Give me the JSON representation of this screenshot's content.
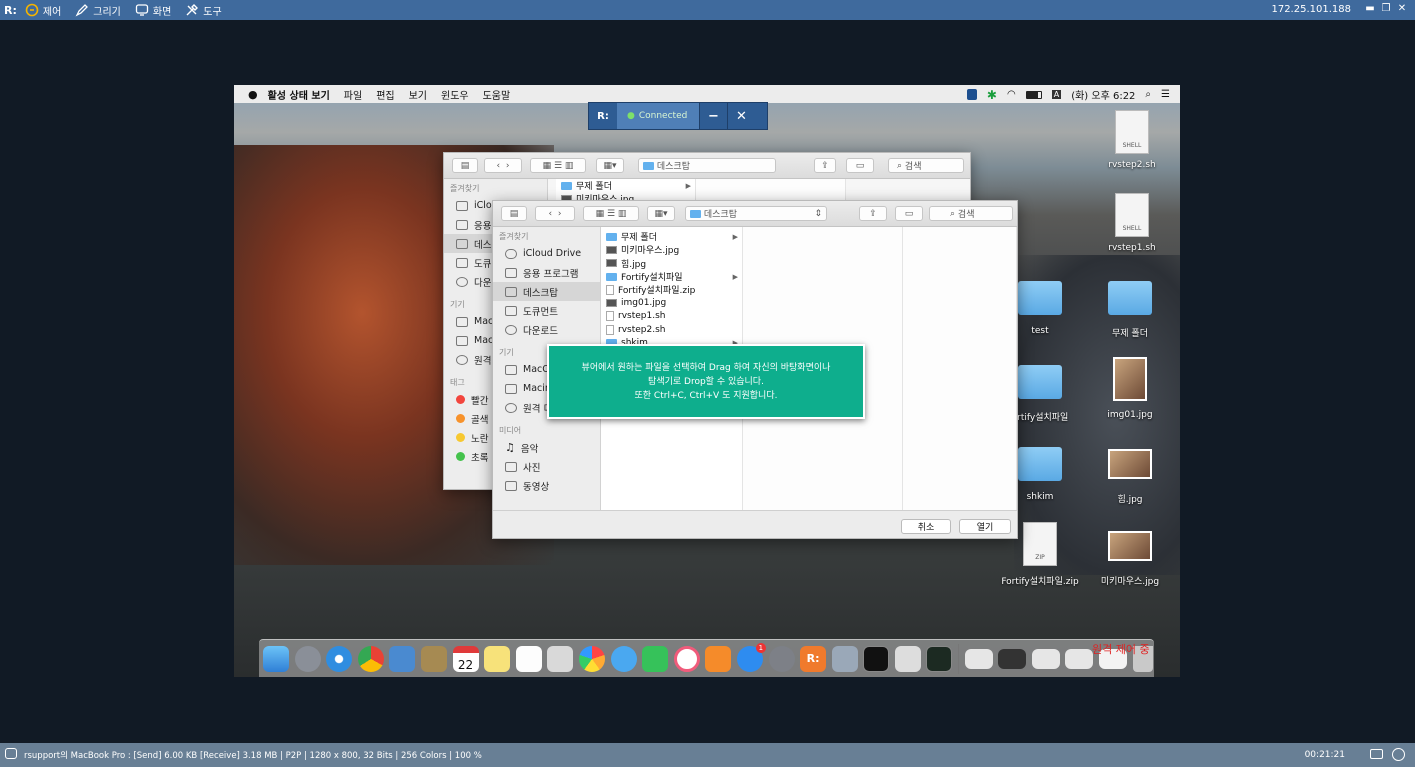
{
  "viewer": {
    "logo": "R:",
    "menu": [
      {
        "label": "제어",
        "icon": "control-icon"
      },
      {
        "label": "그리기",
        "icon": "pen-icon"
      },
      {
        "label": "화면",
        "icon": "screen-icon"
      },
      {
        "label": "도구",
        "icon": "tools-icon"
      }
    ],
    "ip": "172.25.101.188"
  },
  "connection": {
    "logo": "R:",
    "status": "Connected",
    "minimize": "−",
    "close": "✕"
  },
  "mac_menubar": {
    "items": [
      "활성 상태 보기",
      "파일",
      "편집",
      "보기",
      "윈도우",
      "도움말"
    ],
    "clock": "(화) 오후 6:22",
    "input_source": "A"
  },
  "back_finder": {
    "location": "데스크탑",
    "search": "검색",
    "favorites_header": "즐겨찾기",
    "favorites": [
      "iClo",
      "응용",
      "데스",
      "도큐",
      "다운"
    ],
    "devices_header": "기기",
    "devices": [
      "Mac",
      "Mac",
      "원격"
    ],
    "tags_header": "태그",
    "tags": [
      "빨간",
      "골색",
      "노란",
      "초록"
    ],
    "files": [
      "무제 폴더",
      "미키마우스.jpg"
    ]
  },
  "front_finder": {
    "location": "데스크탑",
    "search": "검색",
    "favorites_header": "즐겨찾기",
    "favorites": [
      "iCloud Drive",
      "응용 프로그램",
      "데스크탑",
      "도큐먼트",
      "다운로드"
    ],
    "devices_header": "기기",
    "devices": [
      "MacO",
      "Macin",
      "원격 디"
    ],
    "media_header": "미디어",
    "media": [
      "음악",
      "사진",
      "동영상"
    ],
    "files": [
      "무제 폴더",
      "미키마우스.jpg",
      "힘.jpg",
      "Fortify설치파일",
      "Fortify설치파일.zip",
      "img01.jpg",
      "rvstep1.sh",
      "rvstep2.sh",
      "shkim"
    ],
    "cancel": "취소",
    "open": "열기"
  },
  "toast": {
    "line1": "뷰어에서 원하는 파일을 선택하여 Drag 하여 자신의 바탕화면이나",
    "line2": "탐색기로 Drop할 수 있습니다.",
    "line3": "또한 Ctrl+C, Ctrl+V 도 지원합니다."
  },
  "desktop_icons": [
    "rvstep2.sh",
    "rvstep1.sh",
    "test",
    "무제 폴더",
    "ortify설치파일",
    "img01.jpg",
    "shkim",
    "힘.jpg",
    "Fortify설치파일.zip",
    "미키마우스.jpg"
  ],
  "doc_type_labels": {
    "shell": "SHELL",
    "zip": "ZIP"
  },
  "dock": {
    "calendar_day": "22",
    "badge": "1"
  },
  "remote_note": "원격 제어 중",
  "status_bar": {
    "info": "rsupport의 MacBook Pro : [Send] 6.00 KB  [Receive] 3.18 MB | P2P | 1280 x 800, 32 Bits | 256 Colors | 100 %",
    "timer": "00:21:21"
  }
}
